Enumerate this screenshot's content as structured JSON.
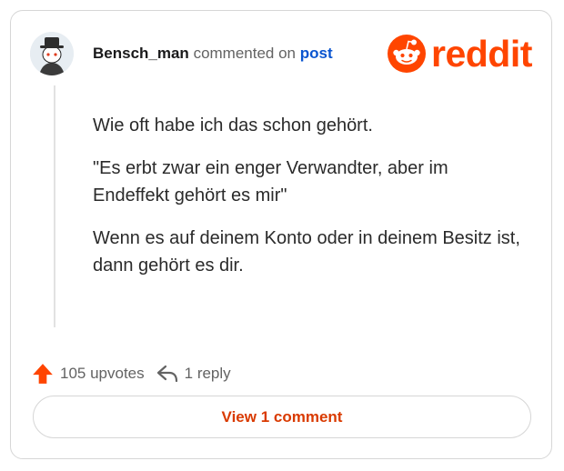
{
  "comment": {
    "author": "Bensch_man",
    "action_text": "commented on",
    "post_link_text": "post",
    "paragraphs": [
      "Wie oft habe ich das schon gehört.",
      "\"Es erbt zwar ein enger Verwandter, aber im Endeffekt gehört es mir\"",
      "Wenn es auf deinem Konto oder in deinem Besitz ist, dann gehört es dir."
    ]
  },
  "brand": {
    "name": "reddit",
    "color": "#ff4500"
  },
  "actions": {
    "upvotes": "105 upvotes",
    "replies": "1 reply"
  },
  "view_button": {
    "label": "View 1 comment"
  },
  "icons": {
    "avatar": "snoo-avatar",
    "logo": "reddit-snoo-icon",
    "upvote": "upvote-arrow-icon",
    "reply": "reply-arrow-icon"
  },
  "colors": {
    "accent": "#ff4500",
    "link": "#0a55d0",
    "button_text": "#d93a00"
  }
}
